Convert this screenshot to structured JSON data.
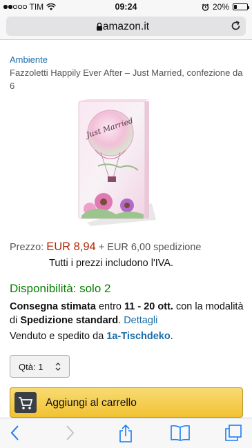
{
  "status_bar": {
    "carrier": "TIM",
    "time": "09:24",
    "battery_percent_label": "20%",
    "battery_level": 0.2
  },
  "browser": {
    "url": "amazon.it"
  },
  "product": {
    "brand": "Ambiente",
    "title": "Fazzoletti Happily Ever After – Just Married, confezione da 6",
    "package_text": "Just Married"
  },
  "pricing": {
    "label": "Prezzo:",
    "price": "EUR 8,94",
    "shipping": "+ EUR 6,00 spedizione",
    "vat_note": "Tutti i prezzi includono l'IVA."
  },
  "availability": {
    "text": "Disponibilità: solo 2"
  },
  "delivery": {
    "label_bold": "Consegna stimata",
    "between": "entro",
    "dates": "11 - 20 ott.",
    "with_text": "con la modalità di",
    "method": "Spedizione standard",
    "period": ".",
    "details_link": "Dettagli"
  },
  "seller": {
    "prefix": "Venduto e spedito da",
    "name": "1a-Tischdeko",
    "suffix": "."
  },
  "quantity": {
    "label": "Qtà:",
    "value": "1"
  },
  "cart_button": {
    "label": "Aggiungi al carrello"
  },
  "colors": {
    "link": "#1a6da8",
    "price": "#b12704",
    "availability": "#067d00",
    "cart_button": "#f1c232"
  },
  "toolbar_icons": [
    "back-icon",
    "forward-icon",
    "share-icon",
    "bookmarks-icon",
    "tabs-icon"
  ]
}
